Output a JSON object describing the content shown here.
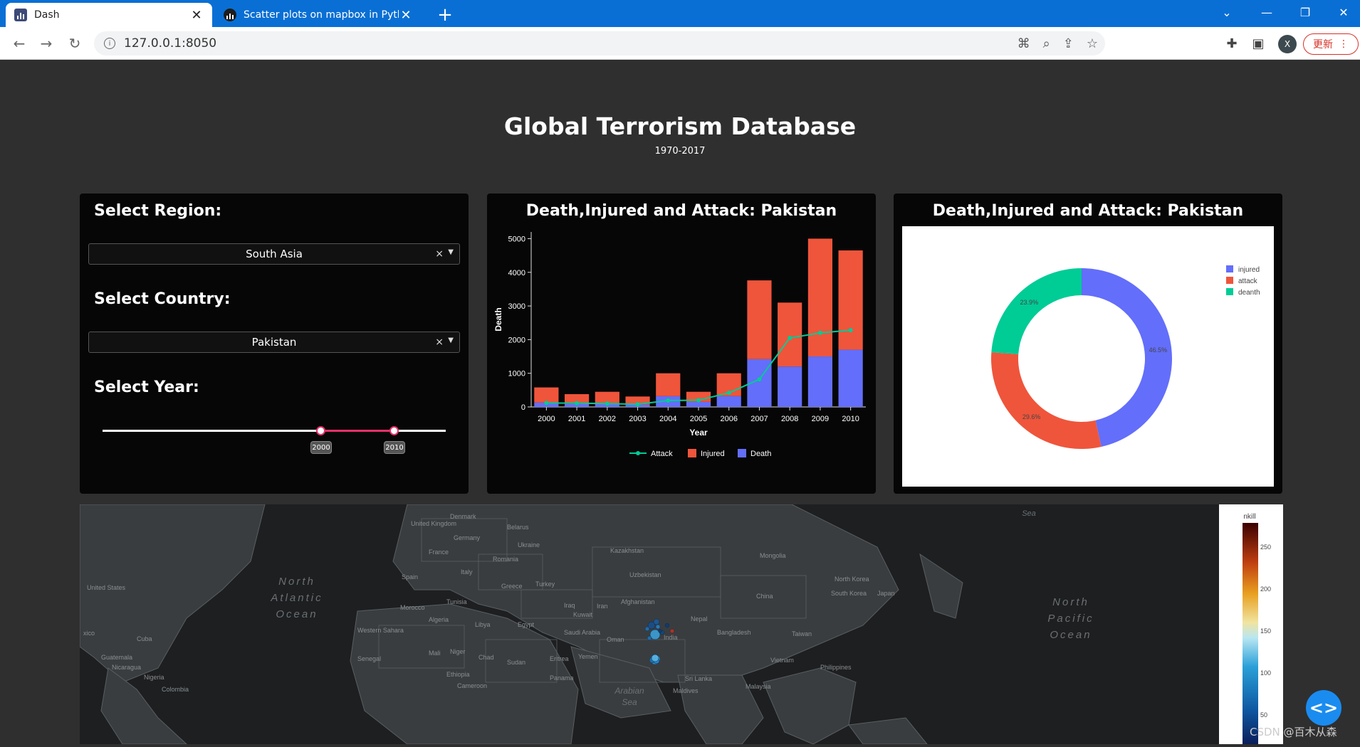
{
  "browser": {
    "tabs": [
      {
        "title": "Dash",
        "active": true
      },
      {
        "title": "Scatter plots on mapbox in Pytho",
        "active": false
      }
    ],
    "url": "127.0.0.1:8050",
    "update_label": "更新",
    "avatar_letter": "X"
  },
  "header": {
    "title": "Global Terrorism Database",
    "subtitle": "1970-2017"
  },
  "controls": {
    "region_label": "Select Region:",
    "region_value": "South Asia",
    "country_label": "Select Country:",
    "country_value": "Pakistan",
    "year_label": "Select Year:",
    "year_start": "2000",
    "year_end": "2010"
  },
  "bar_card": {
    "title": "Death,Injured and Attack: Pakistan"
  },
  "pie_card": {
    "title": "Death,Injured and Attack: Pakistan"
  },
  "chart_data": [
    {
      "type": "bar",
      "categories": [
        "2000",
        "2001",
        "2002",
        "2003",
        "2004",
        "2005",
        "2006",
        "2007",
        "2008",
        "2009",
        "2010"
      ],
      "series": [
        {
          "name": "Death",
          "kind": "bar",
          "color": "#636efa",
          "values": [
            130,
            90,
            110,
            70,
            320,
            150,
            320,
            1420,
            1200,
            1500,
            1700
          ]
        },
        {
          "name": "Injured",
          "kind": "bar",
          "color": "#ef553b",
          "values": [
            450,
            290,
            340,
            240,
            680,
            300,
            680,
            2340,
            1900,
            3500,
            2950
          ]
        },
        {
          "name": "Attack",
          "kind": "line",
          "color": "#00cc96",
          "values": [
            120,
            110,
            100,
            80,
            190,
            200,
            420,
            820,
            2050,
            2200,
            2280
          ]
        }
      ],
      "xlabel": "Year",
      "ylabel": "Death",
      "ylim": [
        0,
        5200
      ],
      "yticks": [
        0,
        1000,
        2000,
        3000,
        4000,
        5000
      ],
      "legend": [
        "Attack",
        "Injured",
        "Death"
      ],
      "legend_position": "bottom"
    },
    {
      "type": "pie",
      "hole": true,
      "labels": [
        "injured",
        "attack",
        "deanth"
      ],
      "values": [
        46.5,
        29.6,
        23.9
      ],
      "text": [
        "46.5%",
        "29.6%",
        "23.9%"
      ],
      "colors": [
        "#636efa",
        "#ef553b",
        "#00cc96"
      ],
      "legend_position": "top-right"
    }
  ],
  "map": {
    "labels": [
      {
        "text": "Denmark"
      },
      {
        "text": "United Kingdom"
      },
      {
        "text": "Belarus"
      },
      {
        "text": "Germany"
      },
      {
        "text": "Ukraine"
      },
      {
        "text": "France"
      },
      {
        "text": "Romania"
      },
      {
        "text": "Kazakhstan"
      },
      {
        "text": "Mongolia"
      },
      {
        "text": "Spain"
      },
      {
        "text": "Italy"
      },
      {
        "text": "Uzbekistan"
      },
      {
        "text": "Turkey"
      },
      {
        "text": "Greece"
      },
      {
        "text": "North Korea"
      },
      {
        "text": "South Korea"
      },
      {
        "text": "Japan"
      },
      {
        "text": "Tunisia"
      },
      {
        "text": "Iraq"
      },
      {
        "text": "Afghanistan"
      },
      {
        "text": "Iran"
      },
      {
        "text": "China"
      },
      {
        "text": "Morocco"
      },
      {
        "text": "Kuwait"
      },
      {
        "text": "Algeria"
      },
      {
        "text": "Libya"
      },
      {
        "text": "Egypt"
      },
      {
        "text": "Nepal"
      },
      {
        "text": "Western Sahara"
      },
      {
        "text": "Saudi Arabia"
      },
      {
        "text": "Oman"
      },
      {
        "text": "Bangladesh"
      },
      {
        "text": "Taiwan"
      },
      {
        "text": "India"
      },
      {
        "text": "Cuba"
      },
      {
        "text": "Mali"
      },
      {
        "text": "Niger"
      },
      {
        "text": "Chad"
      },
      {
        "text": "Sudan"
      },
      {
        "text": "Eritrea"
      },
      {
        "text": "Yemen"
      },
      {
        "text": "Vietnam"
      },
      {
        "text": "Senegal"
      },
      {
        "text": "Philippines"
      },
      {
        "text": "Guatemala"
      },
      {
        "text": "Nicaragua"
      },
      {
        "text": "Nigeria"
      },
      {
        "text": "Ethiopia"
      },
      {
        "text": "Panama"
      },
      {
        "text": "Sri Lanka"
      },
      {
        "text": "Colombia"
      },
      {
        "text": "Cameroon"
      },
      {
        "text": "Malaysia"
      },
      {
        "text": "Maldives"
      },
      {
        "text": "United States"
      },
      {
        "text": "xico"
      }
    ],
    "oceans": [
      {
        "text": "North Atlantic Ocean"
      },
      {
        "text": "North Pacific Ocean"
      },
      {
        "text": "Arabian Sea"
      },
      {
        "text": "Sea"
      }
    ],
    "colorbar": {
      "title": "nkill",
      "ticks": [
        "250",
        "200",
        "150",
        "100",
        "50"
      ]
    }
  },
  "watermark": "CSDN @百木从森"
}
